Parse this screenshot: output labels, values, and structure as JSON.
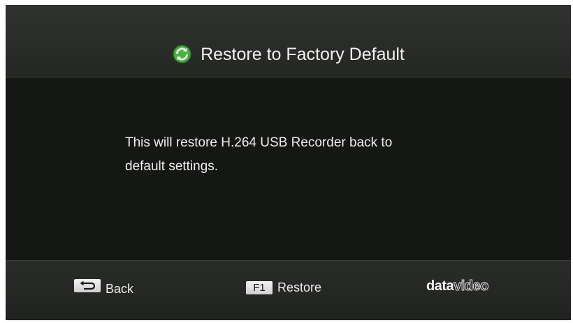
{
  "header": {
    "title": "Restore to Factory Default",
    "icon": "refresh-icon",
    "icon_color": "#3fae3a"
  },
  "message": {
    "line1": "This will restore H.264 USB Recorder back to",
    "line2": "default settings."
  },
  "footer": {
    "back": {
      "key_icon": "return-arrow-icon",
      "label": "Back"
    },
    "restore": {
      "key": "F1",
      "label": "Restore"
    },
    "logo": {
      "part1": "data",
      "part2": "video"
    }
  },
  "colors": {
    "background": "#161815",
    "header": "#2c2e2b",
    "text": "#eeeeee"
  }
}
